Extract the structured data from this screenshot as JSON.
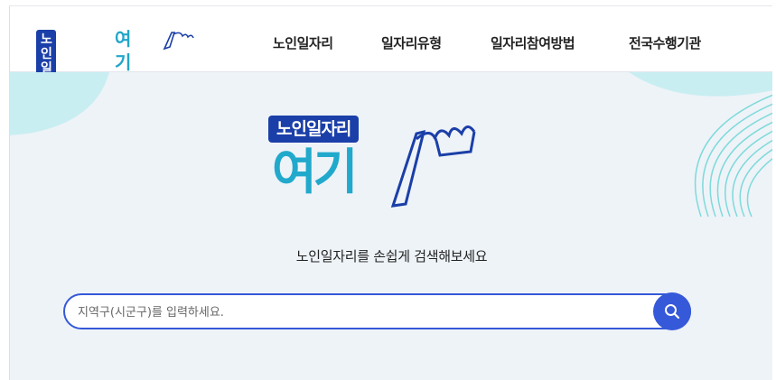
{
  "header": {
    "logo_badge": "노인일자리",
    "logo_yeogi": "여기",
    "nav": [
      "노인일자리",
      "일자리유형",
      "일자리참여방법",
      "전국수행기관"
    ]
  },
  "hero": {
    "logo_badge": "노인일자리",
    "logo_yeogi": "여기",
    "tagline": "노인일자리를 손쉽게 검색해보세요"
  },
  "search": {
    "placeholder": "지역구(시군구)를 입력하세요."
  },
  "colors": {
    "brand_blue": "#1b3fa8",
    "accent_teal": "#22a6c8",
    "search_blue": "#3559d8",
    "hero_bg": "#eef3f8"
  }
}
